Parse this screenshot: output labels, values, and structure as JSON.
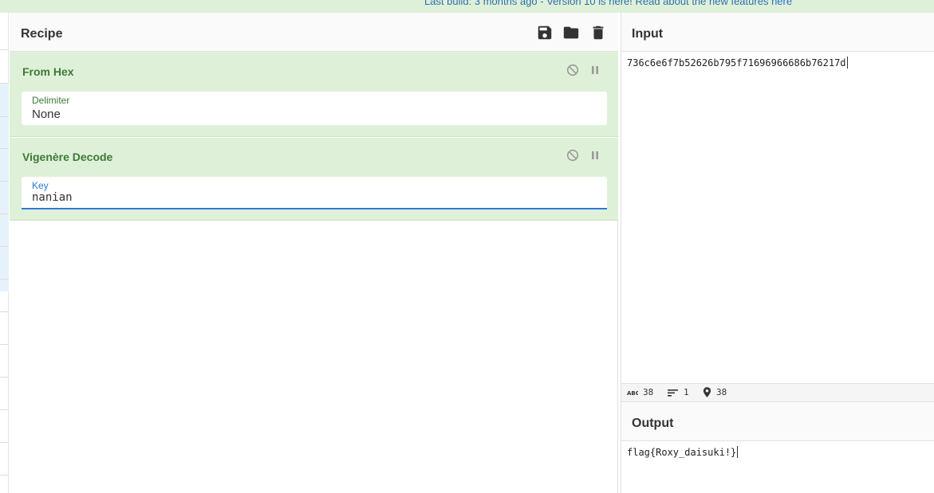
{
  "banner": {
    "text": "Last build: 3 months ago - Version 10 is here! Read about the new features",
    "link": "here"
  },
  "recipe": {
    "title": "Recipe",
    "actions": [
      {
        "name": "save-recipe-button",
        "icon": "save-icon"
      },
      {
        "name": "load-recipe-button",
        "icon": "folder-icon"
      },
      {
        "name": "clear-recipe-button",
        "icon": "trash-icon"
      }
    ],
    "operations": [
      {
        "title": "From Hex",
        "arg_label": "Delimiter",
        "arg_value": "None"
      },
      {
        "title": "Vigenère Decode",
        "arg_label": "Key",
        "arg_value": "nanian"
      }
    ]
  },
  "input": {
    "title": "Input",
    "value": "736c6e6f7b52626b795f71696966686b76217d",
    "stats": {
      "length": "38",
      "lines": "1",
      "position": "38"
    }
  },
  "output": {
    "title": "Output",
    "value": "flag{Roxy_daisuki!}"
  },
  "colors": {
    "op_background": "#dff0d8",
    "op_title": "#3c7a35",
    "link": "#2a6cc7",
    "key_underline": "#2a7ad4"
  }
}
